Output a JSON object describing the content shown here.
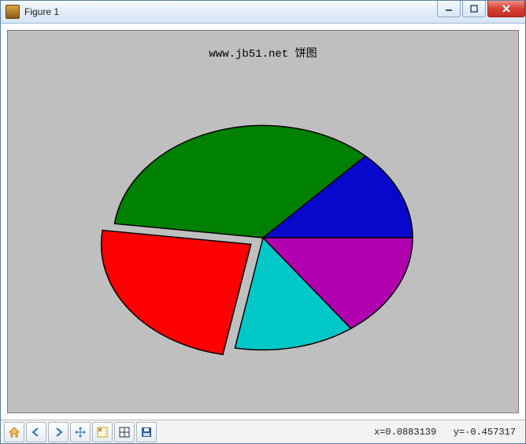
{
  "window": {
    "title": "Figure 1"
  },
  "chart_data": {
    "type": "pie",
    "title": "www.jb51.net 饼图",
    "values": [
      13,
      35,
      24,
      13,
      15
    ],
    "colors": [
      "#0808cc",
      "#008000",
      "#ff0000",
      "#00c8c8",
      "#b000b0"
    ],
    "explode": [
      0,
      0,
      0.1,
      0,
      0
    ],
    "start_angle_deg": 0,
    "direction": "counterclockwise",
    "aspect": 0.75
  },
  "toolbar": {
    "buttons": [
      {
        "name": "home-icon"
      },
      {
        "name": "back-icon"
      },
      {
        "name": "forward-icon"
      },
      {
        "name": "pan-icon"
      },
      {
        "name": "zoom-icon"
      },
      {
        "name": "subplots-icon"
      },
      {
        "name": "save-icon"
      }
    ]
  },
  "status": {
    "coords": "x=0.0883139   y=-0.457317"
  }
}
